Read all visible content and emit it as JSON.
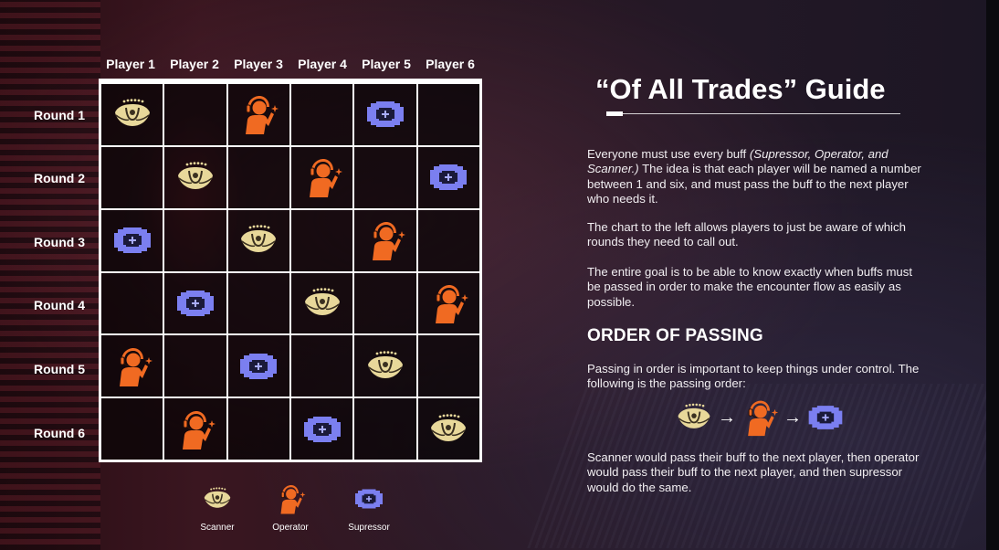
{
  "title": "“Of All Trades” Guide",
  "players": [
    "Player 1",
    "Player 2",
    "Player 3",
    "Player 4",
    "Player 5",
    "Player 6"
  ],
  "rounds": [
    "Round 1",
    "Round 2",
    "Round 3",
    "Round 4",
    "Round 5",
    "Round 6"
  ],
  "grid": [
    [
      "scanner",
      "",
      "operator",
      "",
      "supressor",
      ""
    ],
    [
      "",
      "scanner",
      "",
      "operator",
      "",
      "supressor"
    ],
    [
      "supressor",
      "",
      "scanner",
      "",
      "operator",
      ""
    ],
    [
      "",
      "supressor",
      "",
      "scanner",
      "",
      "operator"
    ],
    [
      "operator",
      "",
      "supressor",
      "",
      "scanner",
      ""
    ],
    [
      "",
      "operator",
      "",
      "supressor",
      "",
      "scanner"
    ]
  ],
  "legend": {
    "scanner": "Scanner",
    "operator": "Operator",
    "supressor": "Supressor"
  },
  "para1_pre": "Everyone must use every buff ",
  "para1_em": "(Supressor, Operator, and Scanner.)",
  "para1_post": " The idea is that each player will be named a number between 1 and six, and must pass the buff to the next player who needs it.",
  "para2": "The chart to the left allows players to just be aware of which rounds they need to call out.",
  "para3": "The entire goal is to be able to know exactly when buffs must be passed in order to make the encounter flow as easily as possible.",
  "section_title": "ORDER OF PASSING",
  "para4": "Passing in order is important to keep things under control. The following is the passing order:",
  "arrow": "→",
  "para5": "Scanner would pass their buff to the next player, then operator would pass their buff to the next player, and then supressor would do the same.",
  "colors": {
    "scanner": "#e8d89a",
    "operator": "#f06a22",
    "supressor": "#7b7ff0"
  },
  "icons": {
    "scanner": "scanner-icon",
    "operator": "operator-icon",
    "supressor": "supressor-icon"
  }
}
